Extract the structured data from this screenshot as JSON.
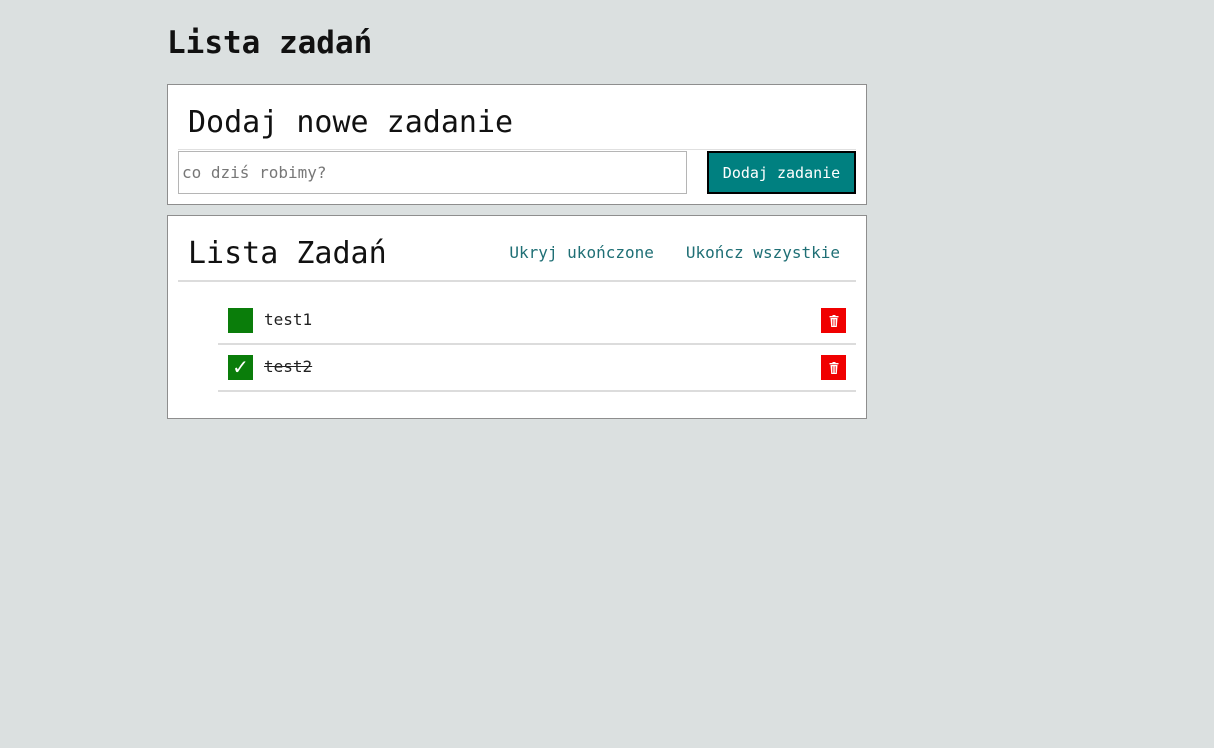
{
  "page_title": "Lista zadań",
  "add_section": {
    "heading": "Dodaj nowe zadanie",
    "input_placeholder": "co dziś robimy?",
    "input_value": "",
    "button_label": "Dodaj zadanie"
  },
  "list_section": {
    "heading": "Lista Zadań",
    "hide_completed_label": "Ukryj ukończone",
    "complete_all_label": "Ukończ wszystkie",
    "tasks": [
      {
        "text": "test1",
        "done": false,
        "check_mark": ""
      },
      {
        "text": "test2",
        "done": true,
        "check_mark": "✓"
      }
    ]
  },
  "colors": {
    "background": "#dbe0e0",
    "accent_button": "#008080",
    "link": "#1f6f75",
    "checkbox": "#0a7d0a",
    "delete": "#f00000"
  },
  "icons": {
    "delete": "trash-icon",
    "check": "check-icon"
  }
}
